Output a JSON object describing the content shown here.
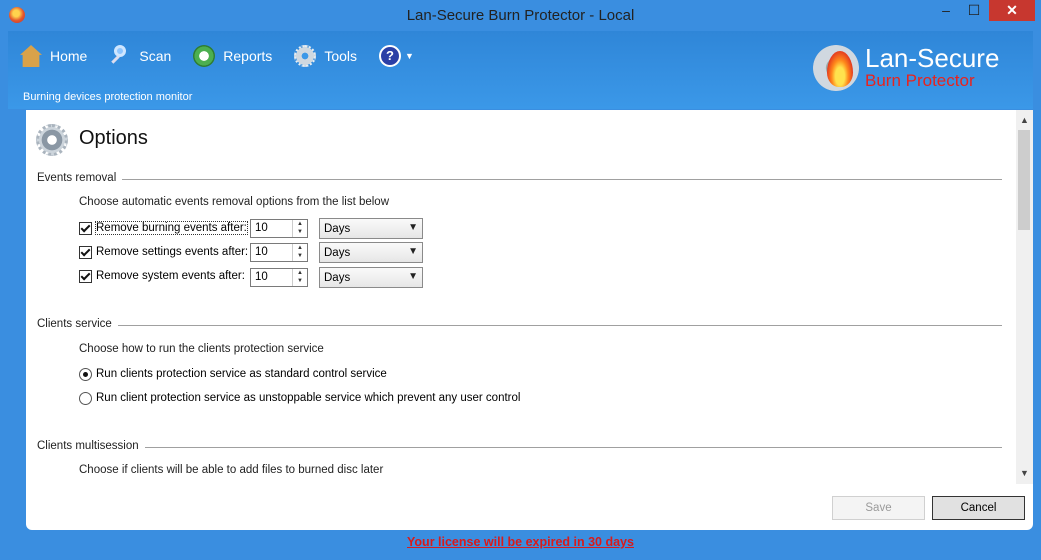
{
  "window": {
    "title": "Lan-Secure Burn Protector - Local"
  },
  "toolbar": {
    "home": "Home",
    "scan": "Scan",
    "reports": "Reports",
    "tools": "Tools",
    "help": "?"
  },
  "header": {
    "subtitle": "Burning devices protection monitor"
  },
  "brand": {
    "name": "Lan-Secure",
    "product": "Burn Protector"
  },
  "page": {
    "title": "Options"
  },
  "events_removal": {
    "section": "Events removal",
    "description": "Choose automatic events removal options from the list below",
    "rows": [
      {
        "label": "Remove burning events after:",
        "checked": true,
        "value": "10",
        "unit": "Days"
      },
      {
        "label": "Remove settings events after:",
        "checked": true,
        "value": "10",
        "unit": "Days"
      },
      {
        "label": "Remove system events after:",
        "checked": true,
        "value": "10",
        "unit": "Days"
      }
    ]
  },
  "clients_service": {
    "section": "Clients service",
    "description": "Choose how to run the clients protection service",
    "options": [
      {
        "label": "Run clients protection service as standard control service",
        "selected": true
      },
      {
        "label": "Run client protection service as unstoppable service which prevent any user control",
        "selected": false
      }
    ]
  },
  "clients_multisession": {
    "section": "Clients multisession",
    "description": "Choose if clients will be able to add files to burned disc later"
  },
  "buttons": {
    "save": "Save",
    "cancel": "Cancel"
  },
  "license": "Your license will be expired in 30 days",
  "colors": {
    "accent": "#3a8ee0",
    "brand_red": "#e8231e",
    "license_red": "#d81b1b"
  }
}
